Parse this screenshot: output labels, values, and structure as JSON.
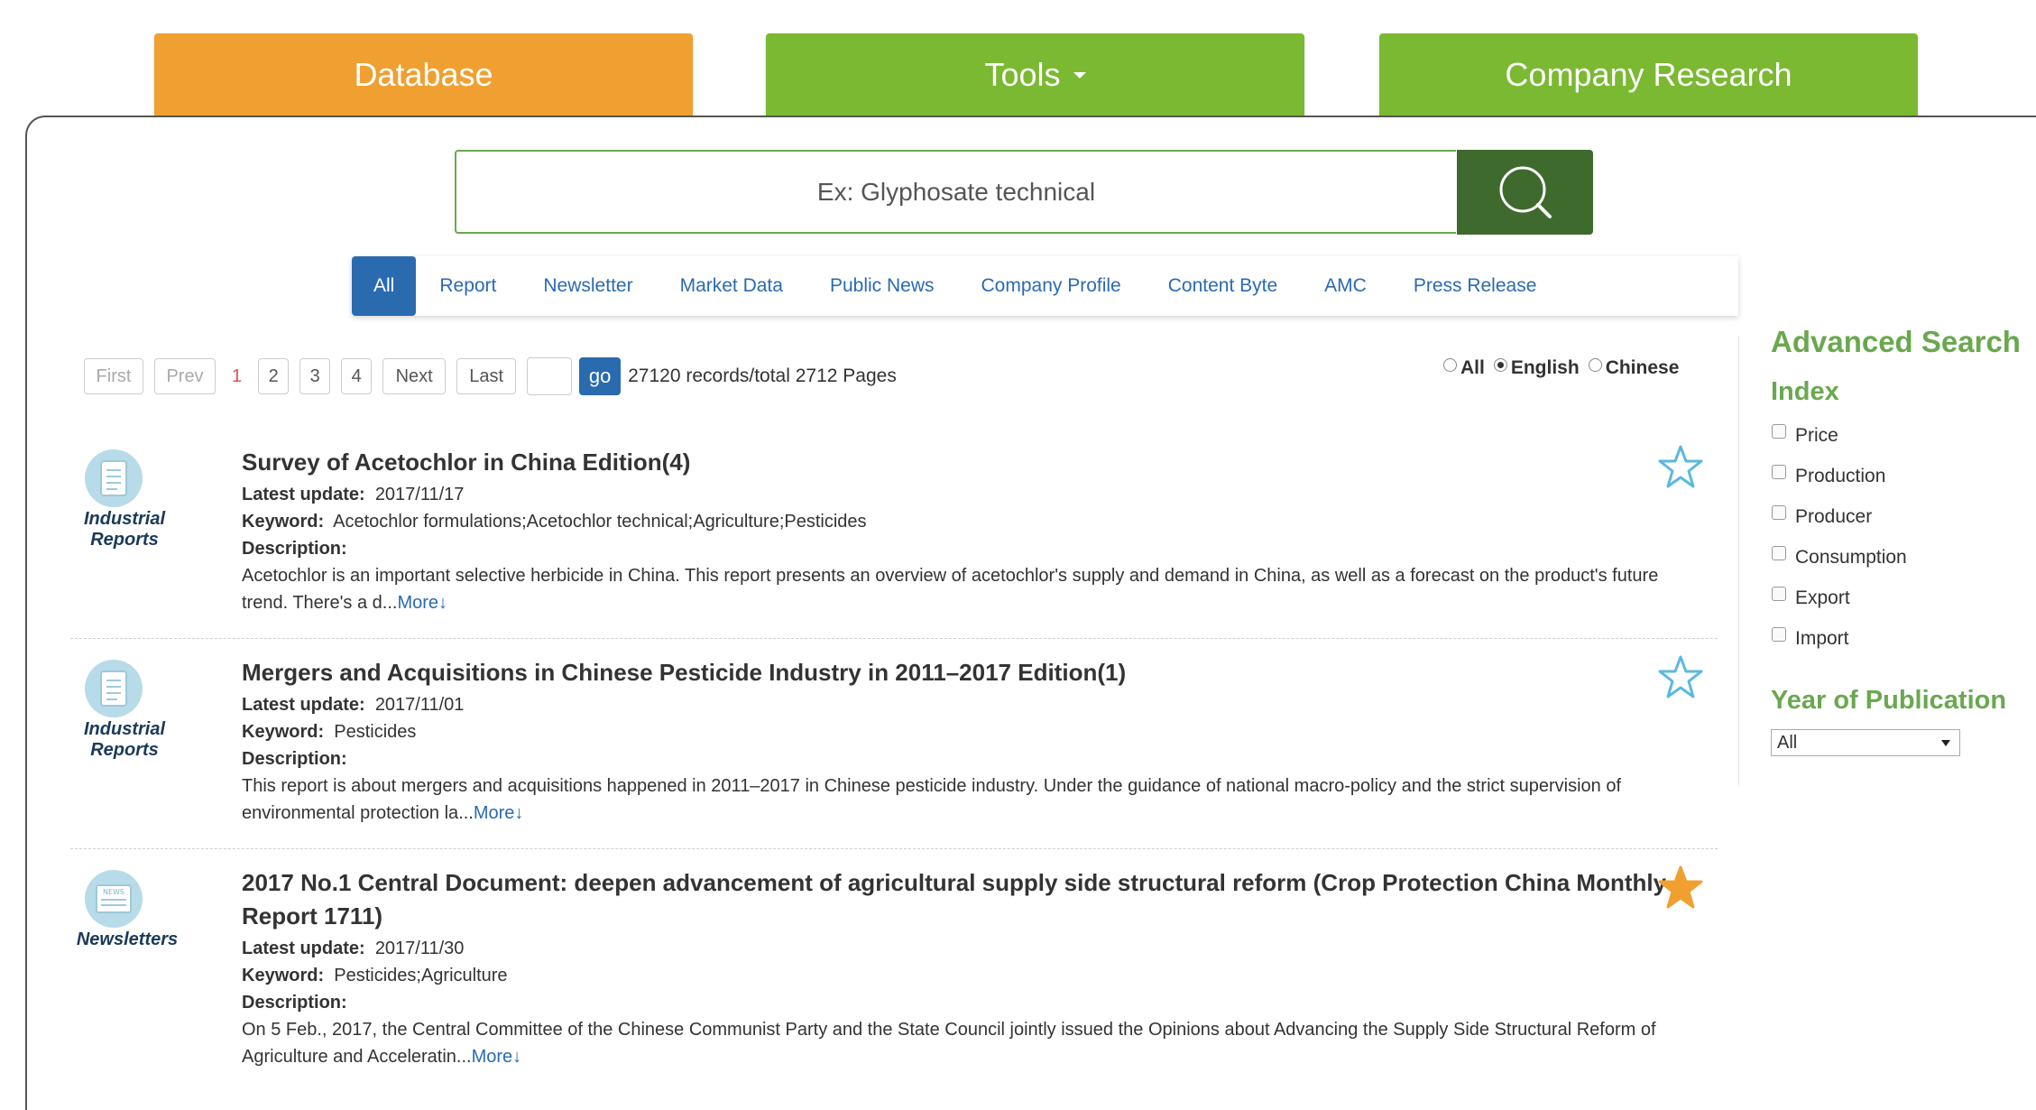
{
  "top_tabs": {
    "database": "Database",
    "tools": "Tools",
    "company": "Company Research"
  },
  "search": {
    "placeholder": "Ex: Glyphosate technical"
  },
  "categories": [
    "All",
    "Report",
    "Newsletter",
    "Market Data",
    "Public News",
    "Company Profile",
    "Content Byte",
    "AMC",
    "Press Release"
  ],
  "pager": {
    "first": "First",
    "prev": "Prev",
    "pages": [
      "1",
      "2",
      "3",
      "4"
    ],
    "next": "Next",
    "last": "Last",
    "go": "go",
    "records": "27120 records/total 2712 Pages"
  },
  "language": {
    "all": "All",
    "english": "English",
    "chinese": "Chinese",
    "selected": "English"
  },
  "results": [
    {
      "category": "Industrial Reports",
      "title": "Survey of Acetochlor in China Edition(4)",
      "update_label": "Latest update:",
      "update": "2017/11/17",
      "keyword_label": "Keyword:",
      "keyword": "Acetochlor formulations;Acetochlor technical;Agriculture;Pesticides",
      "desc_label": "Description:",
      "desc": "Acetochlor is an important selective herbicide in China. This report presents an overview of acetochlor's supply and demand in China, as well as a forecast on the product's future trend. There's a d...",
      "more": "More↓",
      "starred": false
    },
    {
      "category": "Industrial Reports",
      "title": "Mergers and Acquisitions in Chinese Pesticide Industry in 2011–2017 Edition(1)",
      "update_label": "Latest update:",
      "update": "2017/11/01",
      "keyword_label": "Keyword:",
      "keyword": "Pesticides",
      "desc_label": "Description:",
      "desc": "This report is about mergers and acquisitions happened in 2011–2017 in Chinese pesticide industry. Under the guidance of national macro-policy and the strict supervision of environmental protection la...",
      "more": "More↓",
      "starred": false
    },
    {
      "category": "Newsletters",
      "title": "2017 No.1 Central Document: deepen advancement of agricultural supply side structural reform (Crop Protection China Monthly Report 1711)",
      "update_label": "Latest update:",
      "update": "2017/11/30",
      "keyword_label": "Keyword:",
      "keyword": "Pesticides;Agriculture",
      "desc_label": "Description:",
      "desc": "On 5 Feb., 2017, the Central Committee of the Chinese Communist Party and the State Council jointly issued the Opinions about Advancing the Supply Side Structural Reform of Agriculture and Acceleratin...",
      "more": "More↓",
      "starred": true
    }
  ],
  "sidebar": {
    "advanced": "Advanced Search",
    "index": "Index",
    "index_items": [
      "Price",
      "Production",
      "Producer",
      "Consumption",
      "Export",
      "Import"
    ],
    "year_title": "Year of Publication",
    "year_value": "All"
  },
  "colors": {
    "database_tab": "#f0a030",
    "green_tab": "#7ab931",
    "search_button": "#3f6a2d",
    "link_blue": "#2a6ab4",
    "star_gold": "#f0a030",
    "star_outline": "#5bb8e0",
    "sidebar_green": "#6aa84f"
  }
}
